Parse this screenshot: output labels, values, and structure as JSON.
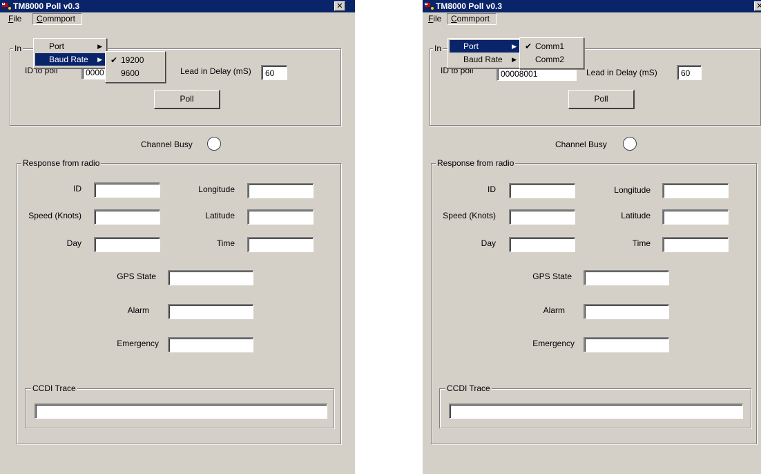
{
  "window": {
    "title": "TM8000 Poll v0.3",
    "close_glyph": "✕",
    "app_icon": "app-flag-icon"
  },
  "menubar": {
    "file": {
      "mnemonic": "F",
      "rest": "ile"
    },
    "commport": {
      "mnemonic": "C",
      "rest": "ommport"
    }
  },
  "commport_menu": {
    "port": "Port",
    "baud_rate": "Baud Rate"
  },
  "baud_submenu": {
    "options": [
      "19200",
      "9600"
    ],
    "checked": "19200"
  },
  "port_submenu": {
    "options": [
      "Comm1",
      "Comm2"
    ],
    "checked": "Comm1"
  },
  "input_group": {
    "label_visible": "In",
    "id_label": "ID to poll",
    "id_value_left": "0000",
    "id_value_right": "00008001",
    "lead_delay_label": "Lead in Delay (mS)",
    "lead_delay_value": "60",
    "poll_button": "Poll"
  },
  "channel_busy_label": "Channel Busy",
  "response_group": {
    "label": "Response from radio",
    "fields": {
      "id": "ID",
      "speed": "Speed (Knots)",
      "day": "Day",
      "longitude": "Longitude",
      "latitude": "Latitude",
      "time": "Time",
      "gps_state": "GPS State",
      "alarm": "Alarm",
      "emergency": "Emergency"
    },
    "values": {
      "id": "",
      "speed": "",
      "day": "",
      "longitude": "",
      "latitude": "",
      "time": "",
      "gps_state": "",
      "alarm": "",
      "emergency": ""
    }
  },
  "ccdi": {
    "label": "CCDI Trace",
    "value": ""
  },
  "colors": {
    "titlebar": "#0a246a",
    "highlight": "#0a246a",
    "face": "#d4d0c8"
  }
}
